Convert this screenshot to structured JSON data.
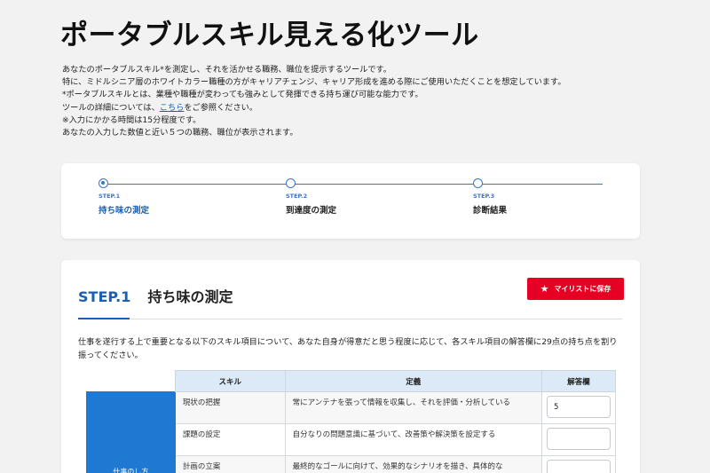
{
  "page": {
    "title": "ポータブルスキル見える化ツール",
    "intro": {
      "line1": "あなたのポータブルスキル*を測定し、それを活かせる職務、職位を提示するツールです。",
      "line2": "特に、ミドルシニア層のホワイトカラー職種の方がキャリアチェンジ、キャリア形成を進める際にご使用いただくことを想定しています。",
      "line3": "*ポータブルスキルとは、業種や職種が変わっても強みとして発揮できる持ち運び可能な能力です。",
      "line4_before": "ツールの詳細については、",
      "line4_link": "こちら",
      "line4_after": "をご参照ください。",
      "line5": "※入力にかかる時間は15分程度です。",
      "line6": "あなたの入力した数値と近い５つの職務、職位が表示されます。"
    }
  },
  "stepper": {
    "steps": [
      {
        "label": "STEP.1",
        "name": "持ち味の測定",
        "active": true
      },
      {
        "label": "STEP.2",
        "name": "到達度の測定",
        "active": false
      },
      {
        "label": "STEP.3",
        "name": "診断結果",
        "active": false
      }
    ],
    "accent_color": "#3b73c4"
  },
  "main": {
    "step_tag": "STEP.1",
    "step_title": "持ち味の測定",
    "save_button": {
      "label": "マイリストに保存",
      "icon": "star-icon",
      "color": "#e60023"
    },
    "instructions": "仕事を遂行する上で重要となる以下のスキル項目について、あなた自身が得意だと思う程度に応じて、各スキル項目の解答欄に29点の持ち点を割り振ってください。",
    "table": {
      "headers": {
        "skill": "スキル",
        "definition": "定義",
        "answer": "解答欄"
      },
      "category": "仕事のし方",
      "category_color": "#1f78d1",
      "rows": [
        {
          "skill": "現状の把握",
          "definition": "常にアンテナを張って情報を収集し、それを評価・分析している",
          "value": "5"
        },
        {
          "skill": "課題の設定",
          "definition": "自分なりの問題意識に基づいて、改善策や解決策を設定する",
          "value": ""
        },
        {
          "skill": "計画の立案",
          "definition": "最終的なゴールに向けて、効果的なシナリオを描き、具体的な",
          "value": ""
        }
      ]
    }
  }
}
